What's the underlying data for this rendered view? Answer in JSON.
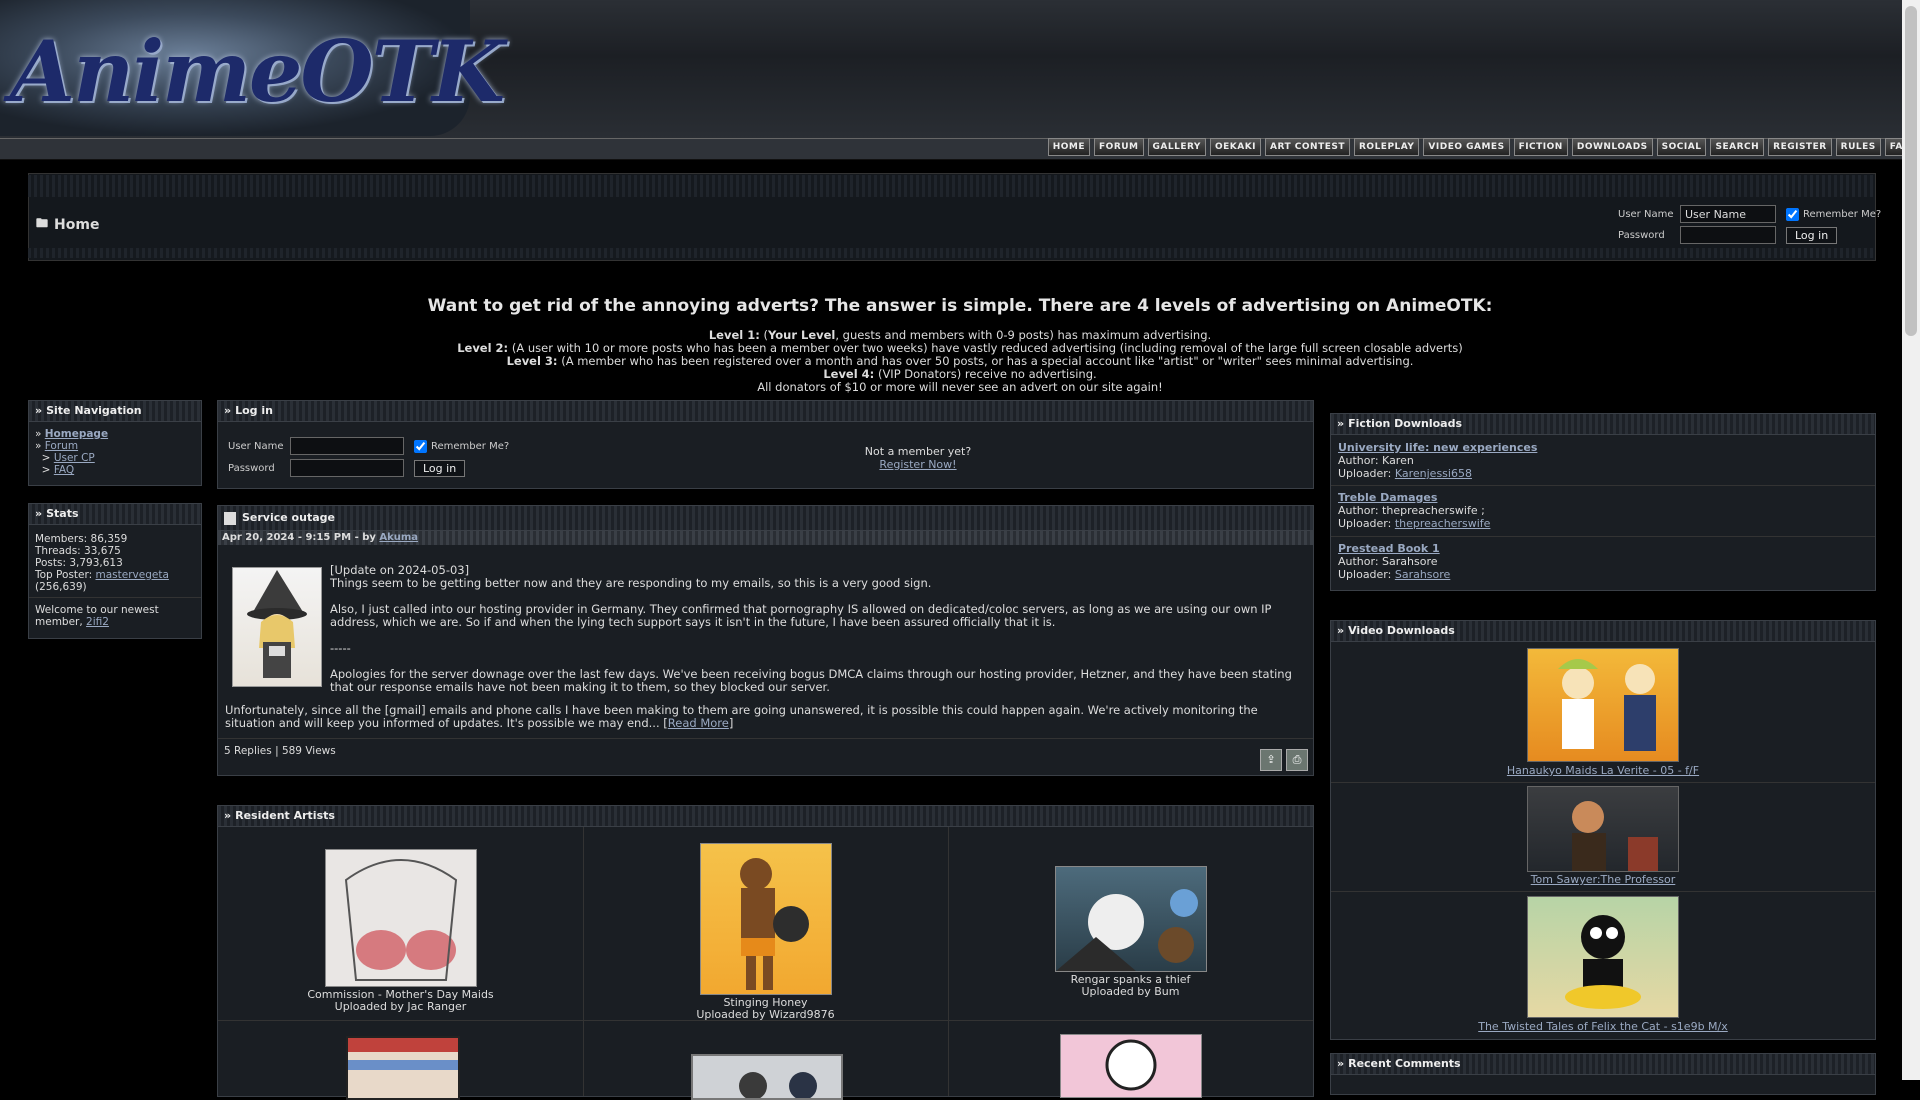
{
  "header": {
    "logo_text": "AnimeOTK",
    "nav": [
      "HOME",
      "FORUM",
      "GALLERY",
      "OEKAKI",
      "ART CONTEST",
      "ROLEPLAY",
      "VIDEO GAMES",
      "FICTION",
      "DOWNLOADS",
      "SOCIAL",
      "SEARCH",
      "REGISTER",
      "RULES",
      "FAQ"
    ]
  },
  "crumb": {
    "home": "Home",
    "login": {
      "username_label": "User Name",
      "username_value": "User Name",
      "remember_label": "Remember Me?",
      "password_label": "Password",
      "login_button": "Log in"
    }
  },
  "advert": {
    "title": "Want to get rid of the annoying adverts? The answer is simple. There are 4 levels of advertising on AnimeOTK:",
    "lines": [
      {
        "level": "Level 1:",
        "text": " (",
        "bold": "Your Level",
        "rest": ", guests and members with 0-9 posts) has maximum advertising."
      },
      {
        "level": "Level 2:",
        "text": " (A user with 10 or more posts who has been a member over two weeks) have vastly reduced advertising (including removal of the large full screen closable adverts)"
      },
      {
        "level": "Level 3:",
        "text": " (A member who has been registered over a month and has over 50 posts, or has a special account like \"artist\" or \"writer\" sees minimal advertising."
      },
      {
        "level": "Level 4:",
        "text": " (VIP Donators) receive no advertising."
      },
      {
        "level": "",
        "text": "All donators of $10 or more will never see an advert on our site again!"
      }
    ]
  },
  "site_nav": {
    "title": "Site Navigation",
    "items": [
      {
        "label": "Homepage",
        "bold": true
      },
      {
        "label": "Forum"
      },
      {
        "label": "User CP",
        "sub": true
      },
      {
        "label": "FAQ",
        "sub": true
      }
    ]
  },
  "stats": {
    "title": "Stats",
    "members": "Members: 86,359",
    "threads": "Threads: 33,675",
    "posts": "Posts: 3,793,613",
    "top_poster_label": "Top Poster: ",
    "top_poster": "mastervegeta",
    "top_poster_count": "(256,639)",
    "welcome": "Welcome to our newest member, ",
    "newest": "2ifi2"
  },
  "login_panel": {
    "title": "Log in",
    "username_label": "User Name",
    "password_label": "Password",
    "remember_label": "Remember Me?",
    "login_button": "Log in",
    "not_member": "Not a member yet?",
    "register": "Register Now!"
  },
  "news": {
    "title": "Service outage",
    "meta_date": "Apr 20, 2024 - 9:15 PM - by ",
    "meta_author": "Akuma",
    "p1": "[Update on 2024-05-03]",
    "p2": "Things seem to be getting better now and they are responding to my emails, so this is a very good sign.",
    "p3": "Also, I just called into our hosting provider in Germany. They confirmed that pornography IS allowed on dedicated/coloc servers, as long as we are using our own IP address, which we are. So if and when the lying tech support says it isn't in the future, I have been assured officially that it is.",
    "p4": "-----",
    "p5": "Apologies for the server downage over the last few days. We've been receiving bogus DMCA claims through our hosting provider, Hetzner, and they have been stating that our response emails have not been making it to them, so they blocked our server.",
    "p6": "Unfortunately, since all the [gmail] emails and phone calls I have been making to them are going unanswered, it is possible this could happen again. We're actively monitoring the situation and will keep you informed of updates. It's possible we may end...",
    "read_more": "Read More",
    "footer": "5 Replies | 589 Views"
  },
  "artists": {
    "title": "Resident Artists",
    "items": [
      {
        "title": "Commission - Mother's Day Maids",
        "by": "Uploaded by Jac Ranger"
      },
      {
        "title": "Stinging Honey",
        "by": "Uploaded by Wizard9876"
      },
      {
        "title": "Rengar spanks a thief",
        "by": "Uploaded by Bum"
      }
    ]
  },
  "fiction": {
    "title": "Fiction Downloads",
    "items": [
      {
        "title": "University life: new experiences",
        "author": "Author: Karen",
        "uploader_label": "Uploader: ",
        "uploader": "Karenjessi658"
      },
      {
        "title": "Treble Damages",
        "author": "Author: thepreacherswife ;",
        "uploader_label": "Uploader: ",
        "uploader": "thepreacherswife"
      },
      {
        "title": "Prestead Book 1",
        "author": "Author: Sarahsore",
        "uploader_label": "Uploader: ",
        "uploader": "Sarahsore"
      }
    ]
  },
  "video": {
    "title": "Video Downloads",
    "items": [
      {
        "title": "Hanaukyo Maids La Verite - 05 - f/F"
      },
      {
        "title": "Tom Sawyer:The Professor"
      },
      {
        "title": "The Twisted Tales of Felix the Cat - s1e9b M/x"
      }
    ]
  },
  "recent": {
    "title": "Recent Comments"
  }
}
